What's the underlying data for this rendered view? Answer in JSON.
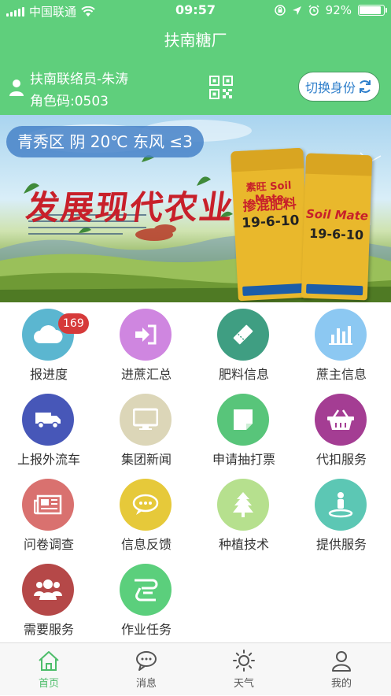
{
  "status_bar": {
    "carrier": "中国联通",
    "time": "09:57",
    "battery": "92%",
    "battery_level": 0.92
  },
  "header": {
    "title": "扶南糖厂",
    "background": "#5fcf7c"
  },
  "user": {
    "name": "扶南联络员-朱涛",
    "role_code": "角色码:0503",
    "switch_label": "切换身份"
  },
  "banner": {
    "weather": "青秀区 阴 20℃ 东风 ≤3",
    "headline": "发展现代农业",
    "bag_brand": "素旺 Soil Mate",
    "bag_product": "掺混肥料",
    "bag_formula": "19-6-10",
    "bag_brand_2": "Soil Mate",
    "bag_formula_2": "19-6-10"
  },
  "menu": [
    {
      "label": "报进度",
      "icon": "cloud-icon",
      "color": "#5bb6d0",
      "badge": "169"
    },
    {
      "label": "进蔗汇总",
      "icon": "sign-in-icon",
      "color": "#cf86e0"
    },
    {
      "label": "肥料信息",
      "icon": "ticket-icon",
      "color": "#3f9e82"
    },
    {
      "label": "蔗主信息",
      "icon": "bar-chart-icon",
      "color": "#8cc8f2"
    },
    {
      "label": "上报外流车",
      "icon": "truck-icon",
      "color": "#4757b8"
    },
    {
      "label": "集团新闻",
      "icon": "monitor-icon",
      "color": "#dcd6b8"
    },
    {
      "label": "申请抽打票",
      "icon": "note-icon",
      "color": "#58c57a"
    },
    {
      "label": "代扣服务",
      "icon": "basket-icon",
      "color": "#a43d93"
    },
    {
      "label": "问卷调查",
      "icon": "newspaper-icon",
      "color": "#d9716f"
    },
    {
      "label": "信息反馈",
      "icon": "chat-icon",
      "color": "#e6c93a"
    },
    {
      "label": "种植技术",
      "icon": "tree-icon",
      "color": "#b6e08e"
    },
    {
      "label": "提供服务",
      "icon": "person-pin-icon",
      "color": "#5cc7b4"
    },
    {
      "label": "需要服务",
      "icon": "group-icon",
      "color": "#b54848"
    },
    {
      "label": "作业任务",
      "icon": "tractor-icon",
      "color": "#5bcf7c"
    }
  ],
  "tabs": [
    {
      "label": "首页",
      "icon": "home-icon",
      "active": true
    },
    {
      "label": "消息",
      "icon": "message-icon",
      "active": false
    },
    {
      "label": "天气",
      "icon": "sun-icon",
      "active": false
    },
    {
      "label": "我的",
      "icon": "user-icon",
      "active": false
    }
  ]
}
